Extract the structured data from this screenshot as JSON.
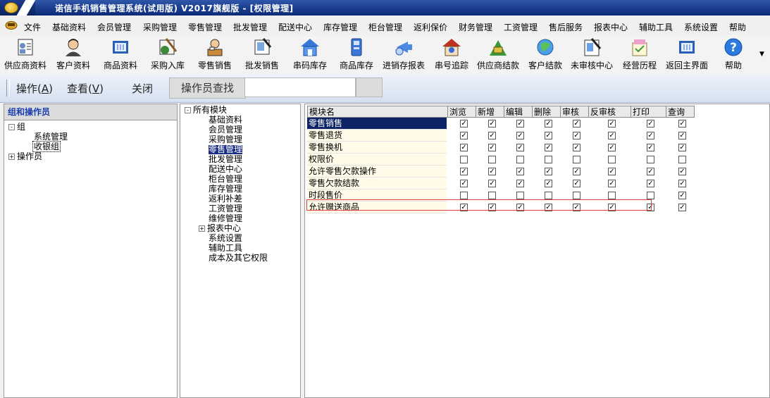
{
  "app": {
    "title": "诺信手机销售管理系统(试用版)  V2017旗舰版 - [权限管理]"
  },
  "menu": [
    "文件",
    "基础资料",
    "会员管理",
    "采购管理",
    "零售管理",
    "批发管理",
    "配送中心",
    "库存管理",
    "柜台管理",
    "返利保价",
    "财务管理",
    "工资管理",
    "售后服务",
    "报表中心",
    "辅助工具",
    "系统设置",
    "帮助"
  ],
  "toolbar": [
    {
      "label": "供应商资料",
      "icon": "supplier-icon"
    },
    {
      "label": "客户资料",
      "icon": "customer-icon"
    },
    {
      "label": "商品资料",
      "icon": "product-icon"
    },
    {
      "label": "采购入库",
      "icon": "purchase-icon"
    },
    {
      "label": "零售销售",
      "icon": "retail-icon"
    },
    {
      "label": "批发销售",
      "icon": "wholesale-icon"
    },
    {
      "label": "串码库存",
      "icon": "serial-stock-icon"
    },
    {
      "label": "商品库存",
      "icon": "product-stock-icon"
    },
    {
      "label": "进销存报表",
      "icon": "report-icon"
    },
    {
      "label": "串号追踪",
      "icon": "tracking-icon"
    },
    {
      "label": "供应商结款",
      "icon": "supplier-payment-icon"
    },
    {
      "label": "客户结款",
      "icon": "customer-payment-icon"
    },
    {
      "label": "未审核中心",
      "icon": "unaudited-icon"
    },
    {
      "label": "经营历程",
      "icon": "history-icon"
    },
    {
      "label": "返回主界面",
      "icon": "home-icon"
    },
    {
      "label": "帮助",
      "icon": "help-icon"
    }
  ],
  "opbar": {
    "operate": "操作(",
    "operate_key": "A",
    "operate_end": ")",
    "view": "查看(",
    "view_key": "V",
    "view_end": ")",
    "close": "关闭",
    "search_label": "操作员查找",
    "search_value": ""
  },
  "left_panel": {
    "header": "组和操作员",
    "nodes": [
      {
        "label": "组",
        "toggle": "-"
      },
      {
        "label": "系统管理"
      },
      {
        "label": "收银组"
      },
      {
        "label": "操作员",
        "toggle": "+"
      }
    ]
  },
  "module_tree": {
    "root": "所有模块",
    "root_toggle": "-",
    "items": [
      "基础资料",
      "会员管理",
      "采购管理",
      "零售管理",
      "批发管理",
      "配送中心",
      "柜台管理",
      "库存管理",
      "返利补差",
      "工资管理",
      "维修管理",
      "报表中心",
      "系统设置",
      "辅助工具",
      "成本及其它权限"
    ],
    "expandable_toggle": "+"
  },
  "permission_grid": {
    "columns": [
      "模块名",
      "浏览",
      "新增",
      "编辑",
      "删除",
      "审核",
      "反审核",
      "打印",
      "查询"
    ],
    "check_mark": "✓",
    "rows": [
      {
        "name": "零售销售",
        "checks": [
          true,
          true,
          true,
          true,
          true,
          true,
          true,
          true
        ]
      },
      {
        "name": "零售退货",
        "checks": [
          true,
          true,
          true,
          true,
          true,
          true,
          true,
          true
        ]
      },
      {
        "name": "零售换机",
        "checks": [
          true,
          true,
          true,
          true,
          true,
          true,
          true,
          true
        ]
      },
      {
        "name": "权限价",
        "checks": [
          false,
          false,
          false,
          false,
          false,
          false,
          false,
          false
        ]
      },
      {
        "name": "允许零售欠款操作",
        "checks": [
          true,
          true,
          true,
          true,
          true,
          true,
          true,
          true
        ]
      },
      {
        "name": "零售欠款结款",
        "checks": [
          true,
          true,
          true,
          true,
          true,
          true,
          true,
          true
        ]
      },
      {
        "name": "时段售价",
        "checks": [
          false,
          false,
          false,
          false,
          false,
          false,
          false,
          true
        ]
      },
      {
        "name": "允许赠送商品",
        "checks": [
          true,
          true,
          true,
          true,
          true,
          true,
          true,
          true
        ]
      }
    ]
  },
  "colors": {
    "title_bar": "#0a2a78",
    "selection": "#0c2466",
    "panel_header_text": "#1a3fb0",
    "highlight_box": "#e04040"
  }
}
